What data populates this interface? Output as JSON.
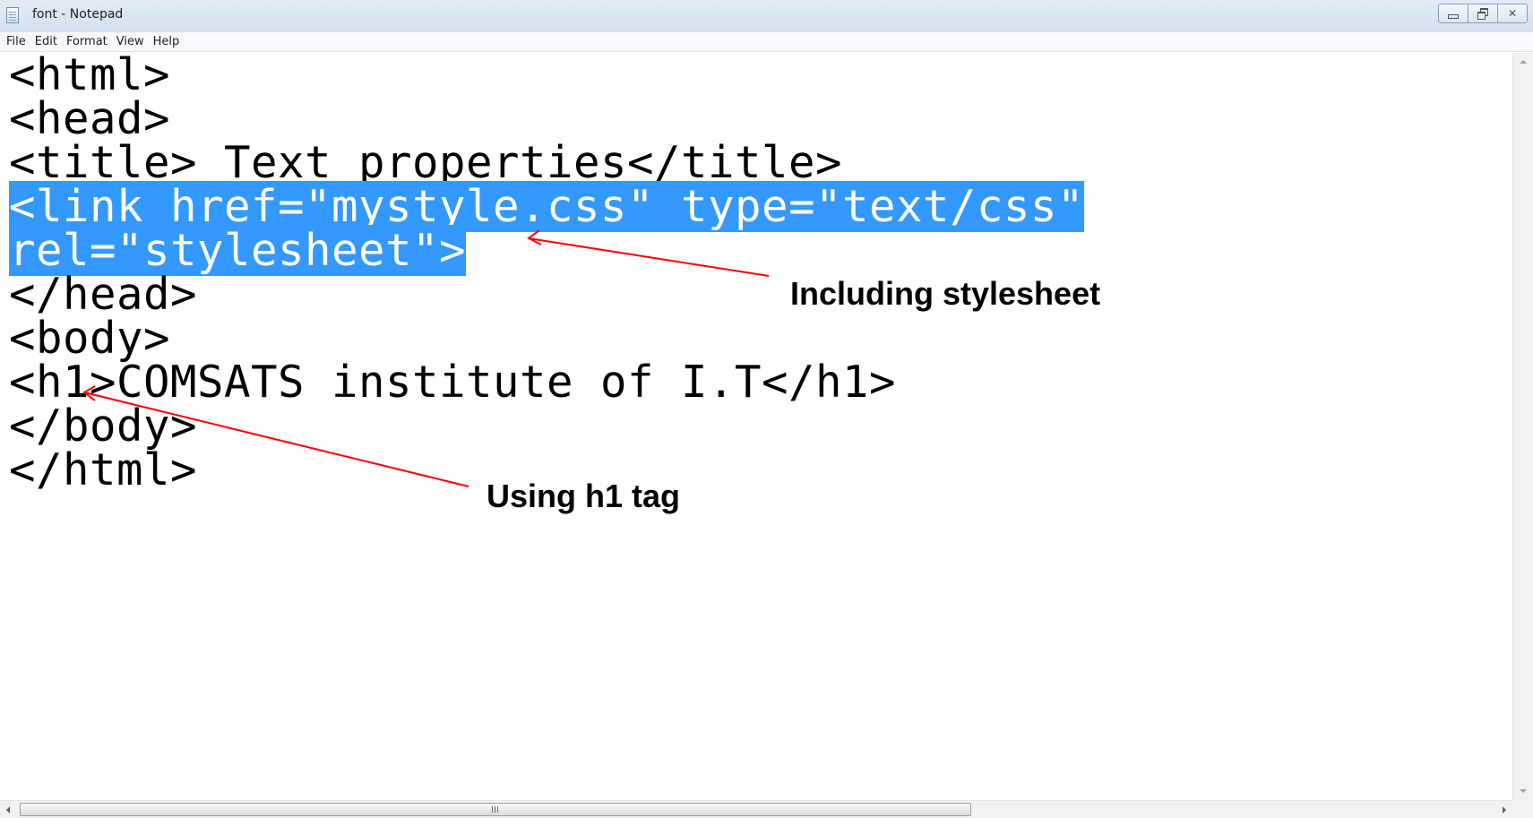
{
  "window": {
    "title": "font - Notepad"
  },
  "menu": {
    "items": [
      "File",
      "Edit",
      "Format",
      "View",
      "Help"
    ]
  },
  "editor": {
    "lines": [
      "<html>",
      "<head>",
      "<title> Text properties</title>",
      "<link href=\"mystyle.css\" type=\"text/css\"",
      "rel=\"stylesheet\">",
      "</head>",
      "<body>",
      "<h1>COMSATS institute of I.T</h1>",
      "</body>",
      "</html>"
    ],
    "selected_lines": [
      4,
      5
    ]
  },
  "annotations": {
    "stylesheet": "Including stylesheet",
    "h1": "Using h1 tag"
  },
  "colors": {
    "selection": "#3399ff",
    "annotation_arrow": "#ff0000"
  }
}
